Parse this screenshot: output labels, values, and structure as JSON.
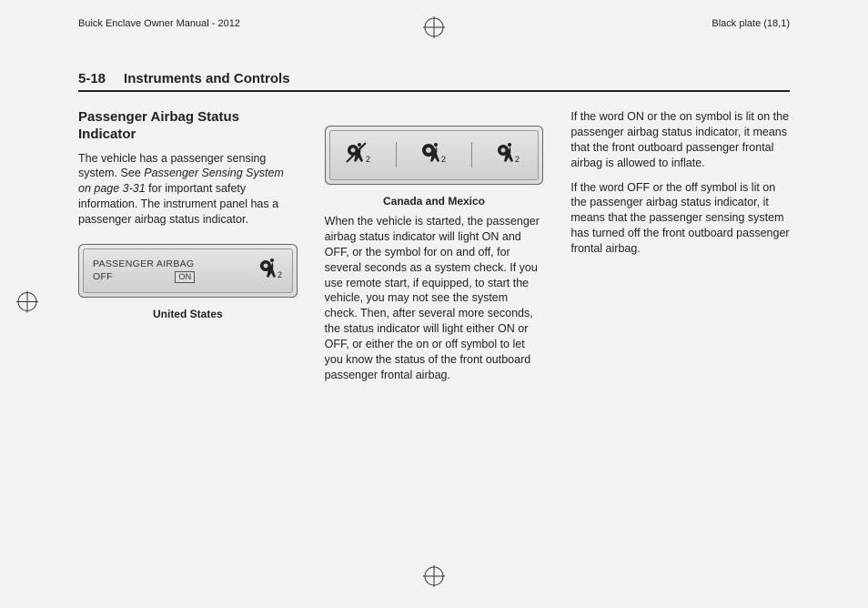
{
  "meta": {
    "manual": "Buick Enclave Owner Manual - 2012",
    "plate": "Black plate (18,1)"
  },
  "header": {
    "page_number": "5-18",
    "chapter": "Instruments and Controls"
  },
  "col1": {
    "heading": "Passenger Airbag Status Indicator",
    "p1a": "The vehicle has a passenger sensing system. See ",
    "p1b_italic": "Passenger Sensing System on page 3-31",
    "p1c": " for important safety information. The instrument panel has a passenger airbag status indicator.",
    "fig_label_line1": "PASSENGER AIRBAG",
    "fig_label_line2": "OFF",
    "fig_on": "ON",
    "caption": "United States"
  },
  "col2": {
    "caption": "Canada and Mexico",
    "p1": "When the vehicle is started, the passenger airbag status indicator will light ON and OFF, or the symbol for on and off, for several seconds as a system check. If you use remote start, if equipped, to start the vehicle, you may not see the system check. Then, after several more seconds, the status indicator will light either ON or OFF, or either the on or off symbol to let you know the status of the front outboard passenger frontal airbag."
  },
  "col3": {
    "p1": "If the word ON or the on symbol is lit on the passenger airbag status indicator, it means that the front outboard passenger frontal airbag is allowed to inflate.",
    "p2": "If the word OFF or the off symbol is lit on the passenger airbag status indicator, it means that the passenger sensing system has turned off the front outboard passenger frontal airbag."
  }
}
